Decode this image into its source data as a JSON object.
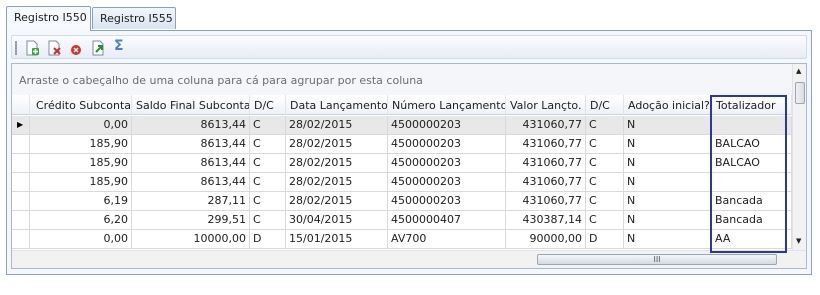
{
  "tabs": [
    {
      "label": "Registro I550",
      "active": true
    },
    {
      "label": "Registro I555",
      "active": false
    }
  ],
  "toolbar": {
    "buttons": [
      "add-icon",
      "delete-icon",
      "cancel-icon",
      "export-icon",
      "sum-icon"
    ],
    "sum_glyph": "Σ"
  },
  "grid": {
    "group_hint": "Arraste o cabeçalho de uma coluna para cá para agrupar por esta coluna",
    "columns": [
      "Crédito Subconta",
      "Saldo Final Subconta",
      "D/C",
      "Data Lançamento",
      "Número Lançamento",
      "Valor Lançto.",
      "D/C",
      "Adoção inicial?",
      "Totalizador"
    ],
    "rows": [
      [
        "0,00",
        "8613,44",
        "C",
        "28/02/2015",
        "4500000203",
        "431060,77",
        "C",
        "N",
        ""
      ],
      [
        "185,90",
        "8613,44",
        "C",
        "28/02/2015",
        "4500000203",
        "431060,77",
        "C",
        "N",
        "BALCAO"
      ],
      [
        "185,90",
        "8613,44",
        "C",
        "28/02/2015",
        "4500000203",
        "431060,77",
        "C",
        "N",
        "BALCAO"
      ],
      [
        "185,90",
        "8613,44",
        "C",
        "28/02/2015",
        "4500000203",
        "431060,77",
        "C",
        "N",
        ""
      ],
      [
        "6,19",
        "287,11",
        "C",
        "28/02/2015",
        "4500000203",
        "431060,77",
        "C",
        "N",
        "Bancada"
      ],
      [
        "6,20",
        "299,51",
        "C",
        "30/04/2015",
        "4500000407",
        "430387,14",
        "C",
        "N",
        "Bancada"
      ],
      [
        "0,00",
        "10000,00",
        "D",
        "15/01/2015",
        "AV700",
        "90000,00",
        "D",
        "N",
        "AA"
      ]
    ],
    "row_indicator": "▶",
    "hscroll_grip": "III"
  },
  "colors": {
    "highlight_border": "#2b36a8",
    "selected_row": "#e8e8e8"
  }
}
